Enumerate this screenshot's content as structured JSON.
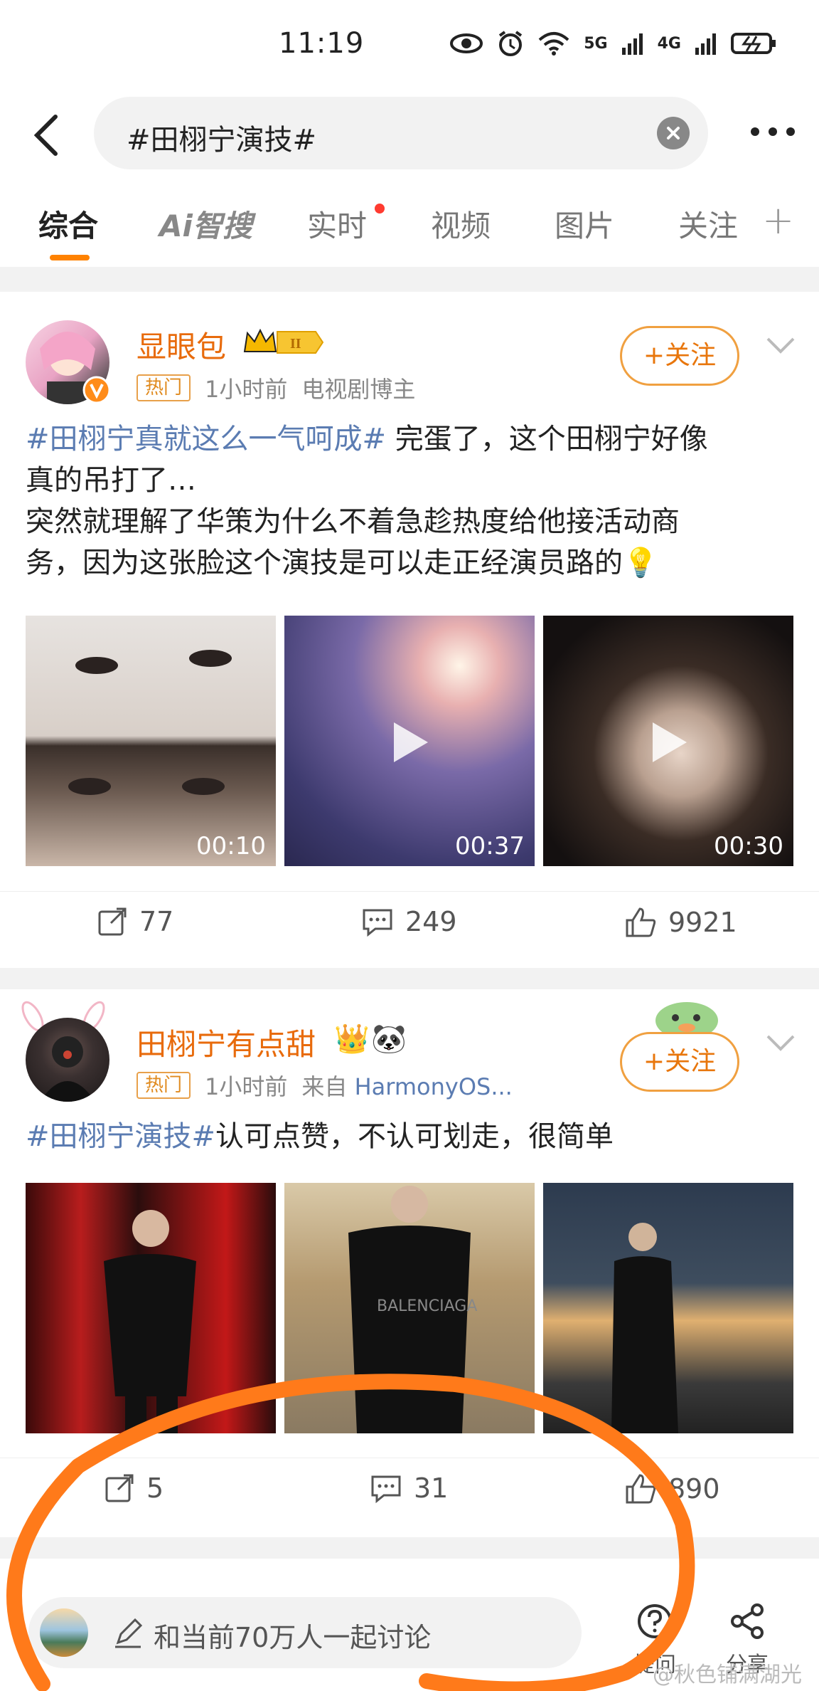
{
  "status_bar": {
    "time": "11:19",
    "net1": "5G",
    "net2": "4G"
  },
  "search": {
    "query": "#田栩宁演技#"
  },
  "tabs": [
    {
      "label": "综合"
    },
    {
      "label": "Ai智搜"
    },
    {
      "label": "实时"
    },
    {
      "label": "视频"
    },
    {
      "label": "图片"
    },
    {
      "label": "关注"
    }
  ],
  "posts": [
    {
      "username": "显眼包",
      "badge": "热门",
      "time": "1小时前",
      "extra": "电视剧博主",
      "follow_label": "+关注",
      "hashtag": "#田栩宁真就这么一气呵成#",
      "text_line1": " 完蛋了，这个田栩宁好像",
      "text_line2": "真的吊打了…",
      "text_line3": "突然就理解了华策为什么不着急趁热度给他接活动商",
      "text_line4": "务，因为这张脸这个演技是可以走正经演员路的",
      "media": [
        {
          "duration": "00:10"
        },
        {
          "duration": "00:37"
        },
        {
          "duration": "00:30"
        }
      ],
      "reposts": "77",
      "comments": "249",
      "likes": "9921"
    },
    {
      "username": "田栩宁有点甜",
      "badge": "热门",
      "time": "1小时前",
      "source_prefix": "来自",
      "source": "HarmonyOS...",
      "follow_label": "+关注",
      "hashtag": "#田栩宁演技#",
      "text": "认可点赞，不认可划走，很简单",
      "reposts": "5",
      "comments": "31",
      "likes": "890"
    }
  ],
  "bottom": {
    "placeholder": "和当前70万人一起讨论",
    "btn1": "提问",
    "btn2": "分享",
    "watermark": "@秋色铺满湖光"
  },
  "colors": {
    "accent": "#ff8200",
    "hashtag": "#5b7cb2",
    "username": "#e86b0c",
    "annotation": "#ff7a1a"
  }
}
